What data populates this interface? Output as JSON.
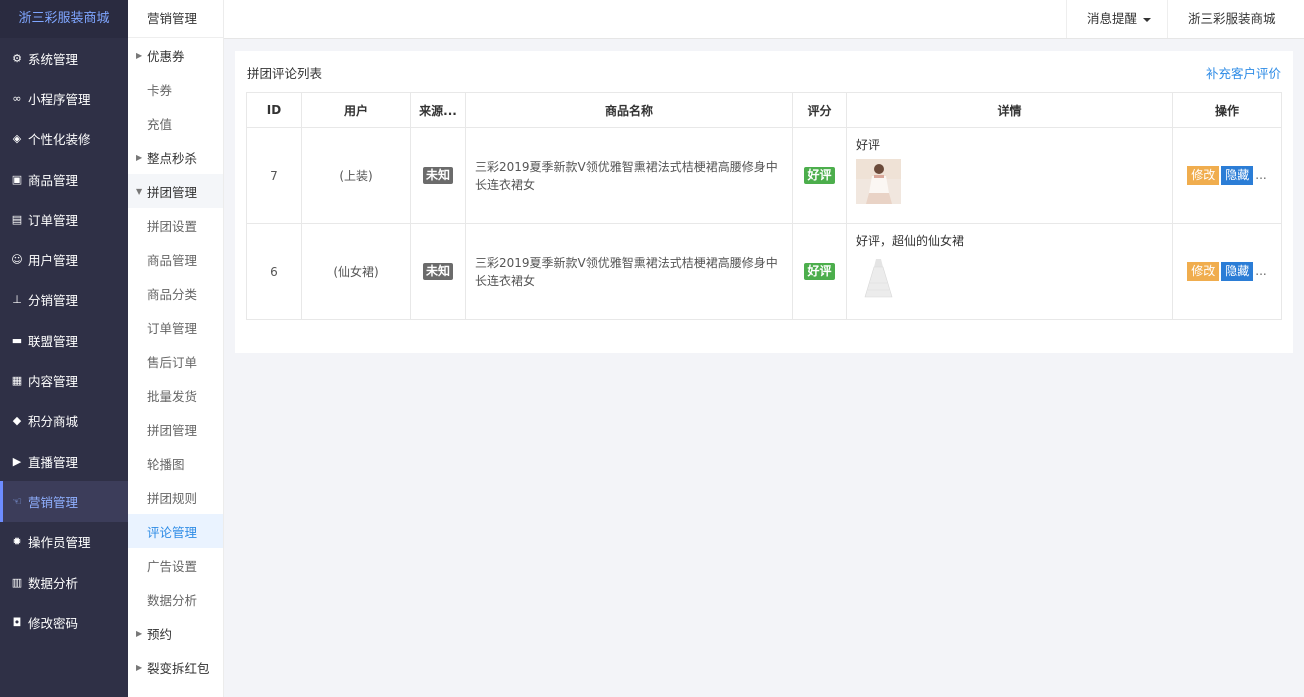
{
  "brand": "浙三彩服装商城",
  "main_menu": [
    {
      "label": "系统管理",
      "icon": "gear-outline-icon"
    },
    {
      "label": "小程序管理",
      "icon": "link-icon"
    },
    {
      "label": "个性化装修",
      "icon": "diamond-icon"
    },
    {
      "label": "商品管理",
      "icon": "bag-icon"
    },
    {
      "label": "订单管理",
      "icon": "clipboard-icon"
    },
    {
      "label": "用户管理",
      "icon": "user-icon"
    },
    {
      "label": "分销管理",
      "icon": "sitemap-icon"
    },
    {
      "label": "联盟管理",
      "icon": "store-icon"
    },
    {
      "label": "内容管理",
      "icon": "newspaper-icon"
    },
    {
      "label": "积分商城",
      "icon": "cube-icon"
    },
    {
      "label": "直播管理",
      "icon": "play-icon"
    },
    {
      "label": "营销管理",
      "icon": "hand-icon",
      "active": true
    },
    {
      "label": "操作员管理",
      "icon": "cog-icon"
    },
    {
      "label": "数据分析",
      "icon": "bar-chart-icon"
    },
    {
      "label": "修改密码",
      "icon": "shield-icon"
    }
  ],
  "sub_menu": {
    "title": "营销管理",
    "items": [
      {
        "label": "优惠券",
        "type": "group",
        "open": false
      },
      {
        "label": "卡券",
        "type": "child"
      },
      {
        "label": "充值",
        "type": "child"
      },
      {
        "label": "整点秒杀",
        "type": "group",
        "open": false
      },
      {
        "label": "拼团管理",
        "type": "group",
        "open": true
      },
      {
        "label": "拼团设置",
        "type": "child"
      },
      {
        "label": "商品管理",
        "type": "child"
      },
      {
        "label": "商品分类",
        "type": "child"
      },
      {
        "label": "订单管理",
        "type": "child"
      },
      {
        "label": "售后订单",
        "type": "child"
      },
      {
        "label": "批量发货",
        "type": "child"
      },
      {
        "label": "拼团管理",
        "type": "child"
      },
      {
        "label": "轮播图",
        "type": "child"
      },
      {
        "label": "拼团规则",
        "type": "child"
      },
      {
        "label": "评论管理",
        "type": "child",
        "active": true
      },
      {
        "label": "广告设置",
        "type": "child"
      },
      {
        "label": "数据分析",
        "type": "child"
      },
      {
        "label": "预约",
        "type": "group",
        "open": false
      },
      {
        "label": "裂变拆红包",
        "type": "group",
        "open": false
      }
    ]
  },
  "topbar": {
    "messages": "消息提醒",
    "account": "浙三彩服装商城"
  },
  "panel": {
    "title": "拼团评论列表",
    "add_link": "补充客户评价",
    "columns": [
      "ID",
      "用户",
      "来源...",
      "商品名称",
      "评分",
      "详情",
      "操作"
    ],
    "rows": [
      {
        "id": "7",
        "user": "(上装)",
        "source": "未知",
        "product": "三彩2019夏季新款V领优雅智熏裙法式桔梗裙高腰修身中长连衣裙女",
        "rating": "好评",
        "detail": "好评",
        "edit": "修改",
        "hide": "隐藏",
        "more": "..."
      },
      {
        "id": "6",
        "user": "(仙女裙)",
        "source": "未知",
        "product": "三彩2019夏季新款V领优雅智熏裙法式桔梗裙高腰修身中长连衣裙女",
        "rating": "好评",
        "detail": "好评，超仙的仙女裙",
        "edit": "修改",
        "hide": "隐藏",
        "more": "..."
      }
    ]
  },
  "colors": {
    "sidebar_bg": "#2f3046",
    "accent_blue": "#2f8ce6",
    "edit_orange": "#f0ad4e",
    "hide_blue": "#2b7dd6",
    "good_green": "#4cae4c"
  }
}
